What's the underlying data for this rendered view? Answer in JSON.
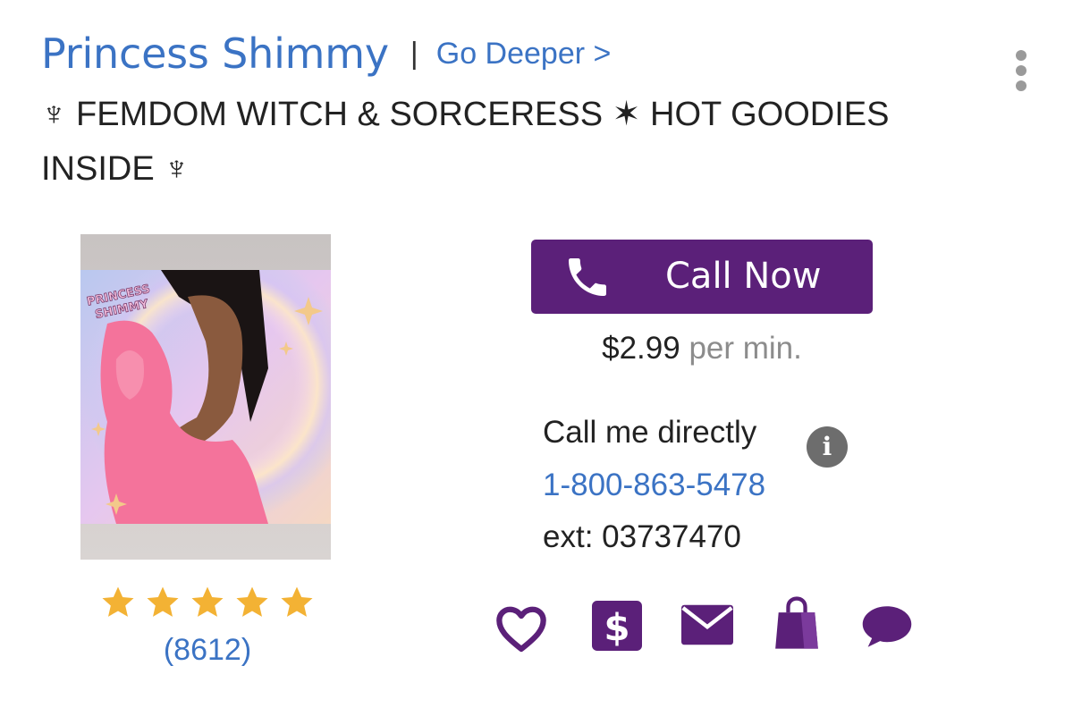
{
  "header": {
    "name": "Princess Shimmy",
    "separator": "|",
    "go_deeper": "Go Deeper >",
    "more_menu_icon": "more-vert-icon"
  },
  "tagline": "♆ FEMDOM WITCH & SORCERESS ✶ HOT GOODIES INSIDE ♆",
  "profile": {
    "photo_text": "PRINCESS SHIMMY",
    "rating": {
      "stars": 5,
      "max": 5,
      "count": "(8612)"
    }
  },
  "call": {
    "button_label": "Call Now",
    "button_icon": "phone-icon",
    "price": "$2.99",
    "per_min": "per min.",
    "direct_label": "Call me directly",
    "info_icon": "i",
    "phone_number": "1-800-863-5478",
    "ext_label": "ext:",
    "ext_value": "03737470"
  },
  "actions": [
    {
      "name": "favorite",
      "icon": "heart-icon"
    },
    {
      "name": "tip",
      "icon": "dollar-icon"
    },
    {
      "name": "message",
      "icon": "mail-icon"
    },
    {
      "name": "shop",
      "icon": "shopping-bag-icon"
    },
    {
      "name": "chat",
      "icon": "chat-bubble-icon"
    }
  ],
  "colors": {
    "link": "#3b73c4",
    "brand_purple": "#5b2079",
    "star": "#f3b234",
    "muted": "#8c8c8c",
    "info_gray": "#6d6d6d"
  }
}
